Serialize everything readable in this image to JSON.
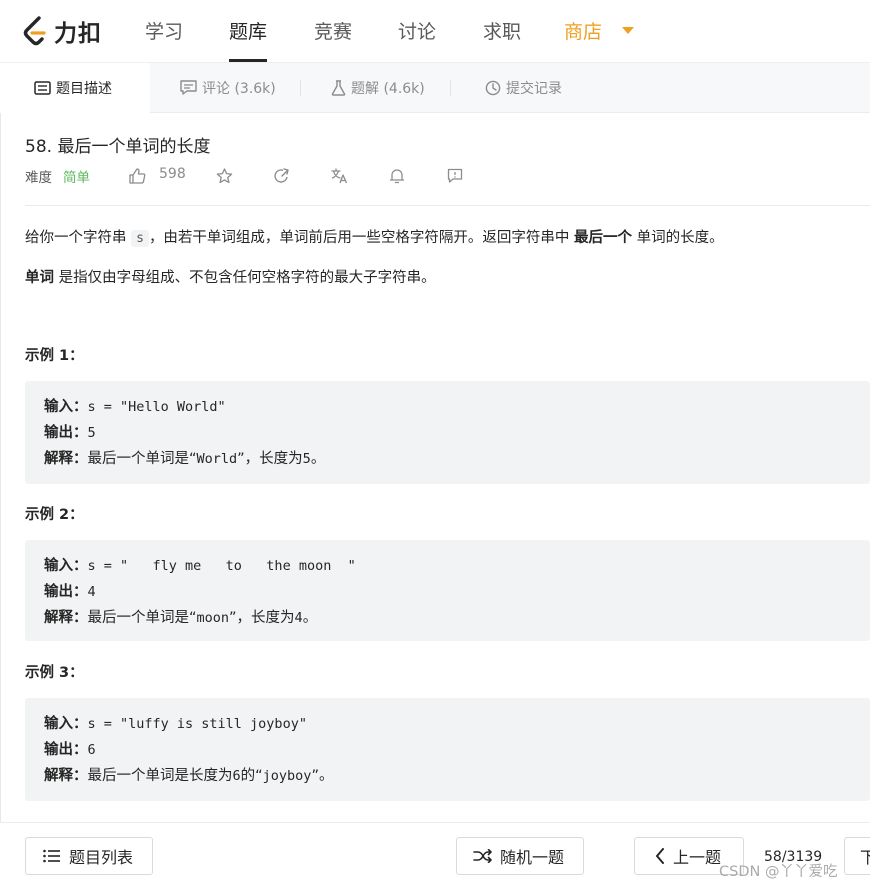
{
  "nav": {
    "logo_text": "力扣",
    "items": [
      "学习",
      "题库",
      "竞赛",
      "讨论",
      "求职",
      "商店"
    ]
  },
  "tabs": [
    "题目描述",
    "评论 (3.6k)",
    "题解 (4.6k)",
    "提交记录"
  ],
  "problem": {
    "title": "58. 最后一个单词的长度",
    "difficulty_label": "难度",
    "difficulty": "简单",
    "likes": "598"
  },
  "description": {
    "p1_a": "给你一个字符串 ",
    "p1_code": "s",
    "p1_b": "，由若干单词组成，单词前后用一些空格字符隔开。返回字符串中 ",
    "p1_bold": "最后一个",
    "p1_c": " 单词的长度。",
    "p2_bold": "单词",
    "p2_rest": " 是指仅由字母组成、不包含任何空格字符的最大子字符串。"
  },
  "examples": [
    {
      "title": "示例 1：",
      "input_label": "输入：",
      "input": "s = \"Hello World\"",
      "output_label": "输出：",
      "output": "5",
      "explain_label": "解释：",
      "explain_a": "最后一个单词是“",
      "explain_code": "World",
      "explain_b": "”，长度为",
      "explain_c": "5",
      "explain_d": "。"
    },
    {
      "title": "示例 2：",
      "input_label": "输入：",
      "input": "s = \"   fly me   to   the moon  \"",
      "output_label": "输出：",
      "output": "4",
      "explain_label": "解释：",
      "explain_a": "最后一个单词是“",
      "explain_code": "moon",
      "explain_b": "”，长度为",
      "explain_c": "4",
      "explain_d": "。"
    },
    {
      "title": "示例 3：",
      "input_label": "输入：",
      "input": "s = \"luffy is still joyboy\"",
      "output_label": "输出：",
      "output": "6",
      "explain_label": "解释：",
      "explain_a": "最后一个单词是长度为",
      "explain_code": "6",
      "explain_b": "的“",
      "explain_c": "joyboy",
      "explain_d": "”。"
    }
  ],
  "bottom": {
    "list_button": "题目列表",
    "random_button": "随机一题",
    "prev_button": "上一题",
    "pager": "58/3139",
    "next_button": "下",
    "watermark": "CSDN @丫丫爱吃"
  },
  "colors": {
    "accent_store": "#f0a020",
    "easy": "#5cb85c",
    "code_bg": "#f2f3f5"
  },
  "icons": [
    "leetcode-logo-icon",
    "caret-down-icon",
    "description-icon",
    "comment-icon",
    "flask-icon",
    "history-icon",
    "thumb-up-icon",
    "star-icon",
    "share-icon",
    "translate-icon",
    "bell-icon",
    "feedback-icon",
    "list-icon",
    "shuffle-icon",
    "chevron-left-icon"
  ]
}
